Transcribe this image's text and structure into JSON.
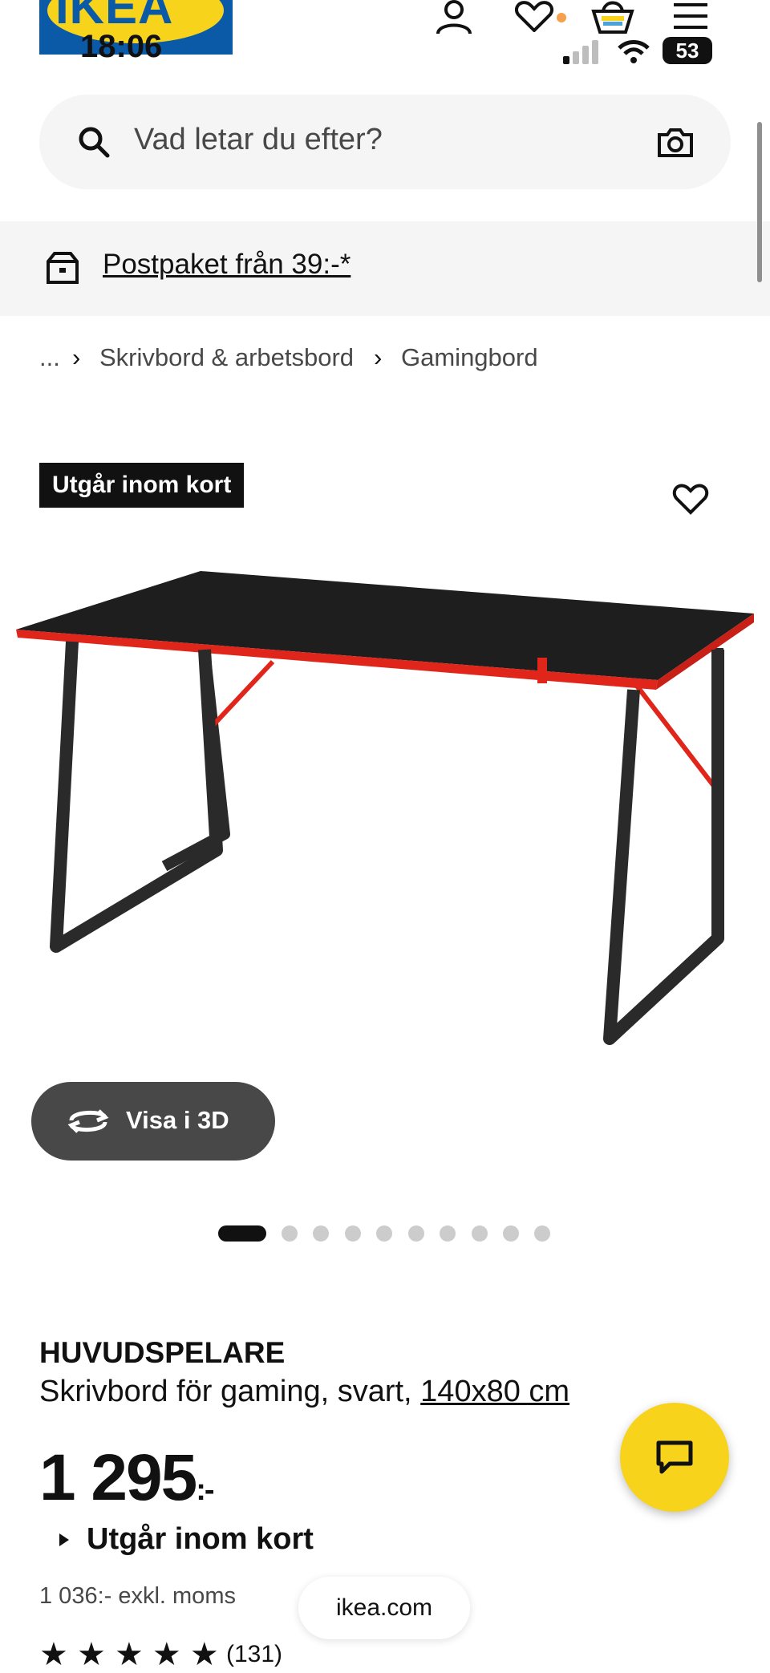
{
  "status_bar": {
    "time": "18:06",
    "battery": "53"
  },
  "header": {
    "logo_text": "IKEA",
    "icons": [
      "profile-icon",
      "heart-icon",
      "basket-icon",
      "menu-icon"
    ],
    "accent_color": "#0058A3",
    "yellow": "#FFDB00"
  },
  "search": {
    "placeholder": "Vad letar du efter?"
  },
  "banner": {
    "text": "Postpaket från 39:-*"
  },
  "breadcrumb": [
    "...",
    "Skrivbord & arbetsbord",
    "Gamingbord"
  ],
  "product": {
    "badge": "Utgår inom kort",
    "view_3d_label": "Visa i 3D",
    "image_count": 10,
    "active_image": 1,
    "name": "HUVUDSPELARE",
    "description": "Skrivbord för gaming, svart, ",
    "size": "140x80 cm",
    "price": "1 295",
    "price_suffix": ":-",
    "status": "Utgår inom kort",
    "price_ex_vat": "1 036:- exkl. moms",
    "rating_stars": "★ ★ ★ ★ ★",
    "rating_count": "(131)"
  },
  "browser": {
    "url": "ikea.com"
  }
}
